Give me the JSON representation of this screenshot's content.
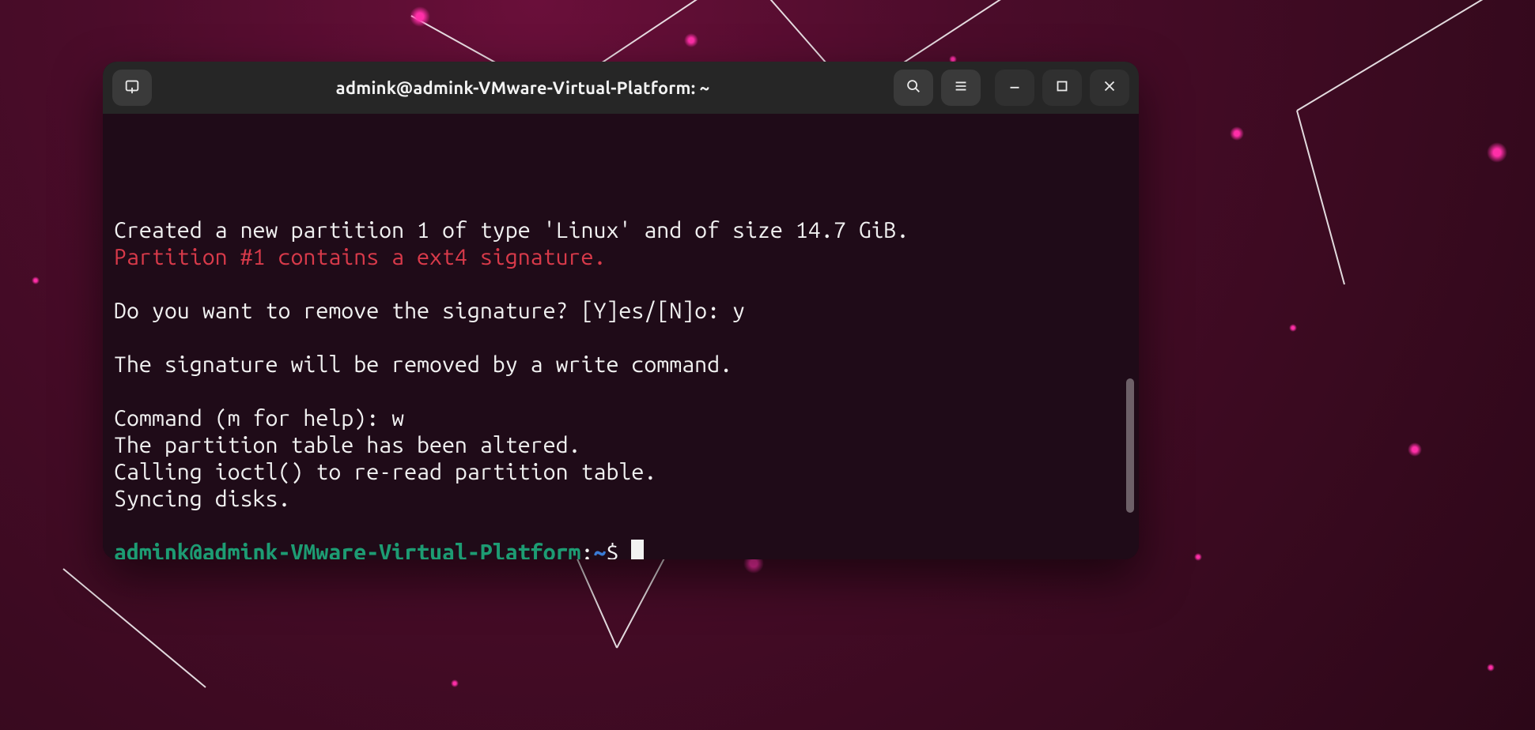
{
  "titlebar": {
    "title": "admink@admink-VMware-Virtual-Platform: ~"
  },
  "terminal": {
    "lines": [
      {
        "segments": [
          {
            "text": ""
          }
        ]
      },
      {
        "segments": [
          {
            "text": "Created a new partition 1 of type 'Linux' and of size 14.7 GiB."
          }
        ]
      },
      {
        "segments": [
          {
            "text": "Partition #1 contains a ext4 signature.",
            "cls": "c-red"
          }
        ]
      },
      {
        "segments": [
          {
            "text": ""
          }
        ]
      },
      {
        "segments": [
          {
            "text": "Do you want to remove the signature? [Y]es/[N]o: y"
          }
        ]
      },
      {
        "segments": [
          {
            "text": ""
          }
        ]
      },
      {
        "segments": [
          {
            "text": "The signature will be removed by a write command."
          }
        ]
      },
      {
        "segments": [
          {
            "text": ""
          }
        ]
      },
      {
        "segments": [
          {
            "text": "Command (m for help): w"
          }
        ]
      },
      {
        "segments": [
          {
            "text": "The partition table has been altered."
          }
        ]
      },
      {
        "segments": [
          {
            "text": "Calling ioctl() to re-read partition table."
          }
        ]
      },
      {
        "segments": [
          {
            "text": "Syncing disks."
          }
        ]
      },
      {
        "segments": [
          {
            "text": ""
          }
        ]
      },
      {
        "segments": [
          {
            "text": "admink@admink-VMware-Virtual-Platform",
            "cls": "c-green"
          },
          {
            "text": ":"
          },
          {
            "text": "~",
            "cls": "c-blue"
          },
          {
            "text": "$ "
          },
          {
            "cursor": true
          }
        ]
      }
    ]
  }
}
